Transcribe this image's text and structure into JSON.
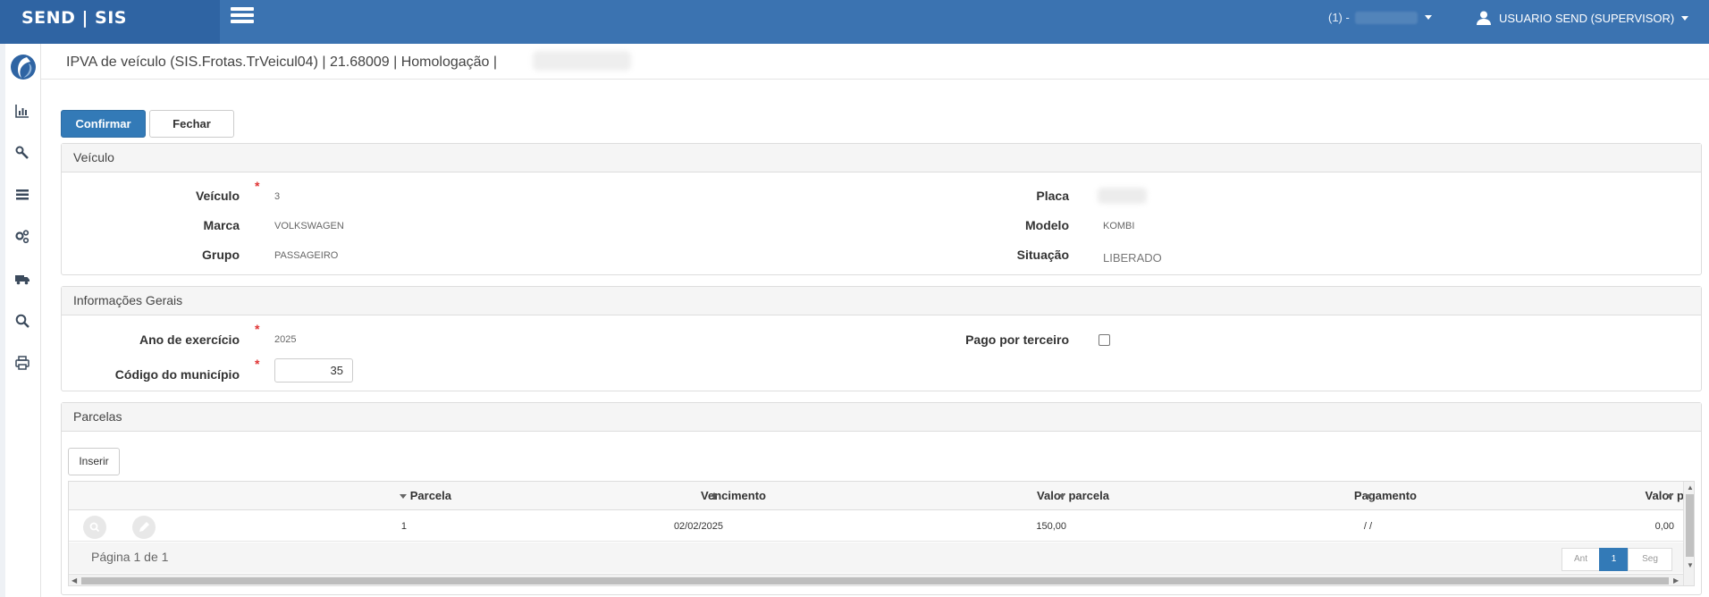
{
  "app": {
    "brand": "SEND | SIS",
    "env_prefix": "(1) -",
    "user": "USUARIO SEND (SUPERVISOR)"
  },
  "title": "IPVA de veículo (SIS.Frotas.TrVeicul04) | 21.68009 | Homologação |",
  "toolbar": {
    "confirm_label": "Confirmar",
    "close_label": "Fechar"
  },
  "sidebar": {
    "items": [
      "chart-icon",
      "wrench-icon",
      "list-icon",
      "gears-icon",
      "truck-icon",
      "search-icon",
      "print-icon"
    ]
  },
  "veiculo_panel": {
    "heading": "Veículo",
    "veiculo_label": "Veículo",
    "veiculo_value": "3",
    "marca_label": "Marca",
    "marca_value": "VOLKSWAGEN",
    "grupo_label": "Grupo",
    "grupo_value": "PASSAGEIRO",
    "placa_label": "Placa",
    "modelo_label": "Modelo",
    "modelo_value": "KOMBI",
    "situacao_label": "Situação",
    "situacao_value": "LIBERADO"
  },
  "info_panel": {
    "heading": "Informações Gerais",
    "ano_label": "Ano de exercício",
    "ano_value": "2025",
    "municipio_label": "Código do município",
    "municipio_value": "35",
    "pago_label": "Pago por terceiro",
    "pago_checked": false
  },
  "parcelas_panel": {
    "heading": "Parcelas",
    "insert_label": "Inserir",
    "columns": [
      "Parcela",
      "Vencimento",
      "Valor parcela",
      "Pagamento",
      "Valor pago"
    ],
    "rows": [
      {
        "parcela": "1",
        "vencimento": "02/02/2025",
        "valor_parcela": "150,00",
        "pagamento": "/ /",
        "valor_pago": "0,00"
      }
    ],
    "page_text": "Página 1 de 1",
    "pager": {
      "prev": "Ant",
      "current": "1",
      "next": "Seg"
    }
  },
  "colors": {
    "topbar": "#3b73b1",
    "brand_bg": "#2f64a3",
    "primary": "#337ab7",
    "required": "#e03333"
  }
}
